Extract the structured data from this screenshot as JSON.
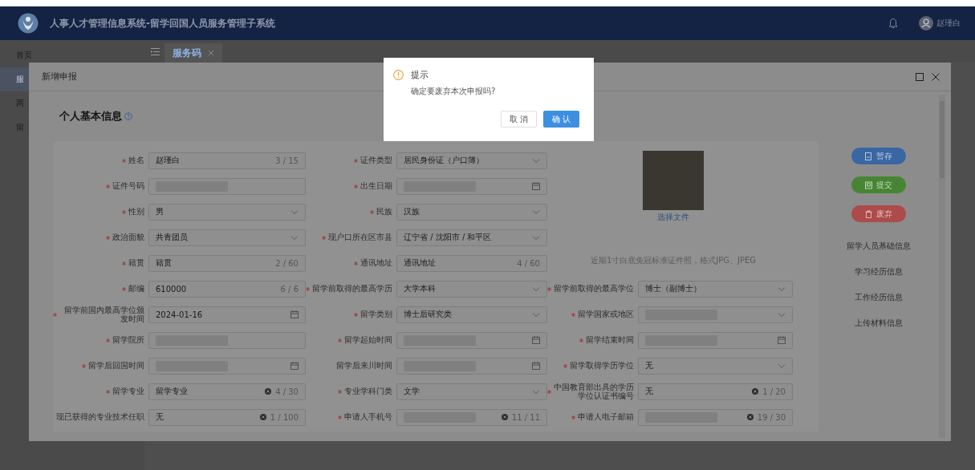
{
  "header": {
    "title": "人事人才管理信息系统-留学回国人员服务管理子系统",
    "user": "赵瑾白"
  },
  "sidebar": {
    "items": [
      {
        "label": "首页",
        "selected": false
      },
      {
        "label": "服",
        "selected": true
      },
      {
        "label": "两",
        "selected": false
      },
      {
        "label": "留",
        "selected": false
      }
    ]
  },
  "tabs": [
    {
      "label": "服务码",
      "selected": true
    }
  ],
  "modal": {
    "title": "新增申报",
    "section_title": "个人基本信息",
    "rows": [
      [
        {
          "label": "姓名",
          "required": true,
          "kind": "text",
          "value": "赵瑾白",
          "counter": "3 / 15"
        },
        {
          "label": "证件类型",
          "required": true,
          "kind": "select",
          "value": "居民身份证（户口簿）"
        }
      ],
      [
        {
          "label": "证件号码",
          "required": true,
          "kind": "text",
          "redacted": true
        },
        {
          "label": "出生日期",
          "required": true,
          "kind": "date",
          "redacted": true
        }
      ],
      [
        {
          "label": "性别",
          "required": true,
          "kind": "select",
          "value": "男"
        },
        {
          "label": "民族",
          "required": true,
          "kind": "select",
          "value": "汉族"
        }
      ],
      [
        {
          "label": "政治面貌",
          "required": true,
          "kind": "select",
          "value": "共青团员"
        },
        {
          "label": "现户口所在区市县",
          "required": true,
          "kind": "select",
          "value": "辽宁省 / 沈阳市 / 和平区"
        }
      ],
      [
        {
          "label": "籍贯",
          "required": true,
          "kind": "text",
          "value": "籍贯",
          "counter": "2 / 60"
        },
        {
          "label": "通讯地址",
          "required": true,
          "kind": "text",
          "value": "通讯地址",
          "counter": "4 / 60"
        }
      ],
      [
        {
          "label": "邮编",
          "required": true,
          "kind": "text",
          "value": "610000",
          "counter": "6 / 6"
        },
        {
          "label": "留学前取得的最高学历",
          "required": true,
          "kind": "select",
          "value": "大学本科"
        },
        {
          "label": "留学前取得的最高学位",
          "required": true,
          "kind": "select",
          "value": "博士（副博士）"
        }
      ],
      [
        {
          "label": "留学前国内最高学位颁发时间",
          "required": true,
          "kind": "date",
          "value": "2024-01-16"
        },
        {
          "label": "留学类别",
          "required": true,
          "kind": "select",
          "value": "博士后研究类"
        },
        {
          "label": "留学国家或地区",
          "required": true,
          "kind": "select",
          "redacted": true
        }
      ],
      [
        {
          "label": "留学院所",
          "required": true,
          "kind": "text",
          "redacted": true
        },
        {
          "label": "留学起始时间",
          "required": true,
          "kind": "date",
          "redacted": true
        },
        {
          "label": "留学结束时间",
          "required": true,
          "kind": "date",
          "redacted": true
        }
      ],
      [
        {
          "label": "留学后回国时间",
          "required": true,
          "kind": "date",
          "redacted": true
        },
        {
          "label": "留学后来川时间",
          "required": false,
          "kind": "date",
          "redacted": true
        },
        {
          "label": "留学取得学历学位",
          "required": true,
          "kind": "select",
          "value": "无"
        }
      ],
      [
        {
          "label": "留学专业",
          "required": true,
          "kind": "text",
          "value": "留学专业",
          "clearable": true,
          "counter": "4 / 30"
        },
        {
          "label": "专业学科门类",
          "required": true,
          "kind": "select",
          "value": "文学"
        },
        {
          "label": "中国教育部出具的学历学位认证书编号",
          "required": true,
          "kind": "text",
          "value": "无",
          "clearable": true,
          "counter": "1 / 20"
        }
      ],
      [
        {
          "label": "现已获得的专业技术任职",
          "required": false,
          "kind": "text",
          "value": "无",
          "clearable": true,
          "counter": "1 / 100"
        },
        {
          "label": "申请人手机号",
          "required": true,
          "kind": "text",
          "redacted": true,
          "clearable": true,
          "counter": "11 / 11"
        },
        {
          "label": "申请人电子邮箱",
          "required": true,
          "kind": "text",
          "redacted": true,
          "clearable": true,
          "counter": "19 / 30"
        }
      ]
    ],
    "photo": {
      "link": "选择文件",
      "hint": "近期1寸白底免冠标准证件照，格式JPG、JPEG"
    },
    "actions": [
      {
        "label": "暂存",
        "kind": "save"
      },
      {
        "label": "提交",
        "kind": "submit"
      },
      {
        "label": "废弃",
        "kind": "discard"
      }
    ],
    "nav": [
      "留学人员基础信息",
      "学习经历信息",
      "工作经历信息",
      "上传材料信息"
    ]
  },
  "confirm": {
    "title": "提示",
    "message": "确定要废弃本次申报吗?",
    "buttons": [
      {
        "label": "取 消",
        "kind": "secondary"
      },
      {
        "label": "确 认",
        "kind": "primary"
      }
    ]
  }
}
